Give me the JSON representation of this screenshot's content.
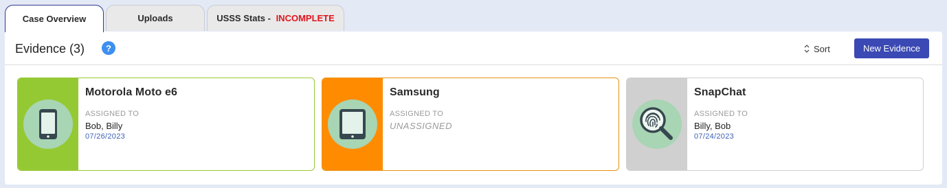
{
  "tabs": [
    {
      "label": "Case Overview",
      "active": true
    },
    {
      "label": "Uploads",
      "active": false
    },
    {
      "label": "USSS Stats - ",
      "status": "INCOMPLETE",
      "active": false
    }
  ],
  "header": {
    "title": "Evidence (3)",
    "help_icon": "?",
    "sort_label": "Sort",
    "new_evidence_label": "New Evidence"
  },
  "evidence": [
    {
      "title": "Motorola Moto e6",
      "assigned_label": "ASSIGNED TO",
      "assignee": "Bob, Billy",
      "date": "07/26/2023",
      "icon": "phone-icon",
      "strip_color": "#95c934",
      "circle_color": "#a8d5b4",
      "border_color": "#95c934"
    },
    {
      "title": "Samsung",
      "assigned_label": "ASSIGNED TO",
      "assignee": "UNASSIGNED",
      "date": "",
      "icon": "tablet-icon",
      "strip_color": "#ff8c00",
      "circle_color": "#a8d5b4",
      "border_color": "#e8920e"
    },
    {
      "title": "SnapChat",
      "assigned_label": "ASSIGNED TO",
      "assignee": "Billy, Bob",
      "date": "07/24/2023",
      "icon": "fingerprint-search-icon",
      "strip_color": "#d0d0d0",
      "circle_color": "#a8d5b4",
      "border_color": "#cfcfcf"
    }
  ]
}
